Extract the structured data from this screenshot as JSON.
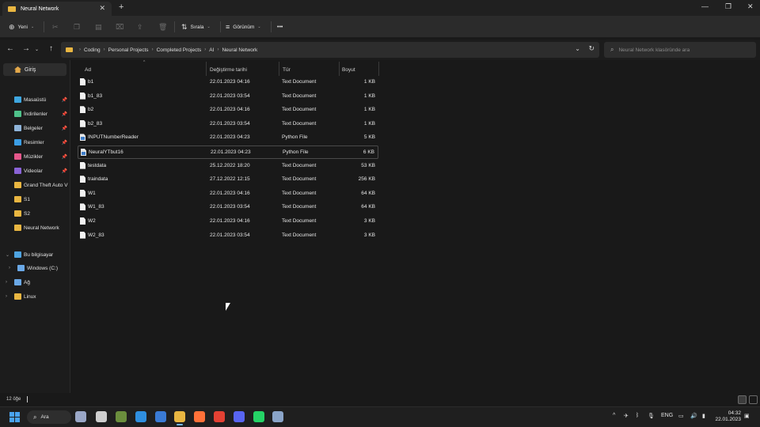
{
  "window": {
    "tab_title": "Neural Network",
    "tab_close": "✕",
    "new_tab": "+",
    "minimize": "—",
    "maximize": "❐",
    "close": "✕"
  },
  "toolbar": {
    "new_label": "Yeni",
    "sort_label": "Sırala",
    "view_label": "Görünüm",
    "more_label": "•••"
  },
  "address": {
    "crumbs": [
      "Coding",
      "Personal Projects",
      "Completed Projects",
      "AI",
      "Neural Network"
    ],
    "search_placeholder": "Neural Network klasöründe ara"
  },
  "sidebar": {
    "home_label": "Giriş",
    "quick_access": [
      {
        "label": "Masaüstü",
        "icon": "desktop-icon",
        "color": "#3ea6e0",
        "pinned": true
      },
      {
        "label": "İndirilenler",
        "icon": "download-icon",
        "color": "#4fc18a",
        "pinned": true
      },
      {
        "label": "Belgeler",
        "icon": "documents-icon",
        "color": "#8fb4d9",
        "pinned": true
      },
      {
        "label": "Resimler",
        "icon": "pictures-icon",
        "color": "#3b9ee6",
        "pinned": true
      },
      {
        "label": "Müzikler",
        "icon": "music-icon",
        "color": "#e5578b",
        "pinned": true
      },
      {
        "label": "Videolar",
        "icon": "videos-icon",
        "color": "#8a63d6",
        "pinned": true
      },
      {
        "label": "Grand Theft Auto V",
        "icon": "folder-icon",
        "color": "#e9b641",
        "pinned": false
      },
      {
        "label": "S1",
        "icon": "folder-icon",
        "color": "#e9b641",
        "pinned": false
      },
      {
        "label": "S2",
        "icon": "folder-icon",
        "color": "#e9b641",
        "pinned": false
      },
      {
        "label": "Neural Network",
        "icon": "folder-icon",
        "color": "#e9b641",
        "pinned": false
      }
    ],
    "tree": [
      {
        "label": "Bu bilgisayar",
        "icon": "pc-icon",
        "color": "#4ea3e0",
        "expanded": true
      },
      {
        "label": "Windows (C:)",
        "icon": "drive-icon",
        "color": "#6aa8e6",
        "expanded": false
      },
      {
        "label": "Ağ",
        "icon": "network-icon",
        "color": "#6aa8e6",
        "expanded": false
      },
      {
        "label": "Linux",
        "icon": "linux-icon",
        "color": "#e9b641",
        "expanded": false
      }
    ]
  },
  "columns": {
    "name": "Ad",
    "modified": "Değiştirme tarihi",
    "type": "Tür",
    "size": "Boyut"
  },
  "files": [
    {
      "name": "b1",
      "modified": "22.01.2023 04:16",
      "type": "Text Document",
      "size": "1 KB",
      "kind": "text"
    },
    {
      "name": "b1_83",
      "modified": "22.01.2023 03:54",
      "type": "Text Document",
      "size": "1 KB",
      "kind": "text"
    },
    {
      "name": "b2",
      "modified": "22.01.2023 04:16",
      "type": "Text Document",
      "size": "1 KB",
      "kind": "text"
    },
    {
      "name": "b2_83",
      "modified": "22.01.2023 03:54",
      "type": "Text Document",
      "size": "1 KB",
      "kind": "text"
    },
    {
      "name": "INPUTNumberReader",
      "modified": "22.01.2023 04:23",
      "type": "Python File",
      "size": "5 KB",
      "kind": "python"
    },
    {
      "name": "NeuralYTbut16",
      "modified": "22.01.2023 04:23",
      "type": "Python File",
      "size": "6 KB",
      "kind": "python"
    },
    {
      "name": "testdata",
      "modified": "25.12.2022 18:20",
      "type": "Text Document",
      "size": "53 KB",
      "kind": "text"
    },
    {
      "name": "traindata",
      "modified": "27.12.2022 12:15",
      "type": "Text Document",
      "size": "256 KB",
      "kind": "text"
    },
    {
      "name": "W1",
      "modified": "22.01.2023 04:16",
      "type": "Text Document",
      "size": "64 KB",
      "kind": "text"
    },
    {
      "name": "W1_83",
      "modified": "22.01.2023 03:54",
      "type": "Text Document",
      "size": "64 KB",
      "kind": "text"
    },
    {
      "name": "W2",
      "modified": "22.01.2023 04:16",
      "type": "Text Document",
      "size": "3 KB",
      "kind": "text"
    },
    {
      "name": "W2_83",
      "modified": "22.01.2023 03:54",
      "type": "Text Document",
      "size": "3 KB",
      "kind": "text"
    }
  ],
  "selected_row": 5,
  "status": {
    "item_count": "12 öğe"
  },
  "taskbar": {
    "search_label": "Ara",
    "apps": [
      {
        "name": "task-view-app",
        "color": "#9aa7c7"
      },
      {
        "name": "obs-app",
        "color": "#cfcfcf"
      },
      {
        "name": "minecraft-app",
        "color": "#6b8e3d"
      },
      {
        "name": "vscode-app",
        "color": "#2f8fe0"
      },
      {
        "name": "app-blue",
        "color": "#3a7bd5"
      },
      {
        "name": "file-explorer-app",
        "color": "#e9b641",
        "active": true
      },
      {
        "name": "firefox-app",
        "color": "#ff7139"
      },
      {
        "name": "chrome-app",
        "color": "#e34133"
      },
      {
        "name": "discord-app",
        "color": "#5865f2"
      },
      {
        "name": "whatsapp-app",
        "color": "#25d366"
      },
      {
        "name": "settings-app",
        "color": "#8aa4c8"
      }
    ],
    "language": "ENG",
    "time": "04:32",
    "date": "22.01.2023"
  }
}
